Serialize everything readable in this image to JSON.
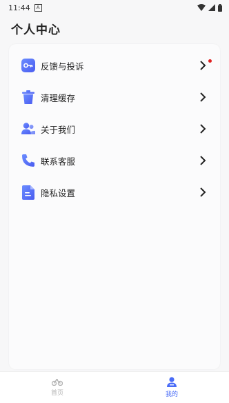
{
  "status_bar": {
    "time": "11:44",
    "notif_glyph": "A"
  },
  "header": {
    "title": "个人中心"
  },
  "menu": [
    {
      "label": "反馈与投诉",
      "icon": "key-icon",
      "badge": true
    },
    {
      "label": "清理缓存",
      "icon": "trash-icon",
      "badge": false
    },
    {
      "label": "关于我们",
      "icon": "users-icon",
      "badge": false
    },
    {
      "label": "联系客服",
      "icon": "phone-icon",
      "badge": false
    },
    {
      "label": "隐私设置",
      "icon": "document-icon",
      "badge": false
    }
  ],
  "bottom_nav": {
    "home_label": "首页",
    "mine_label": "我的",
    "active": "我的"
  },
  "colors": {
    "accent": "#4a6cf7",
    "badge": "#e02020",
    "icon_gradient_start": "#6a8cff",
    "icon_gradient_end": "#4a5cf0"
  }
}
